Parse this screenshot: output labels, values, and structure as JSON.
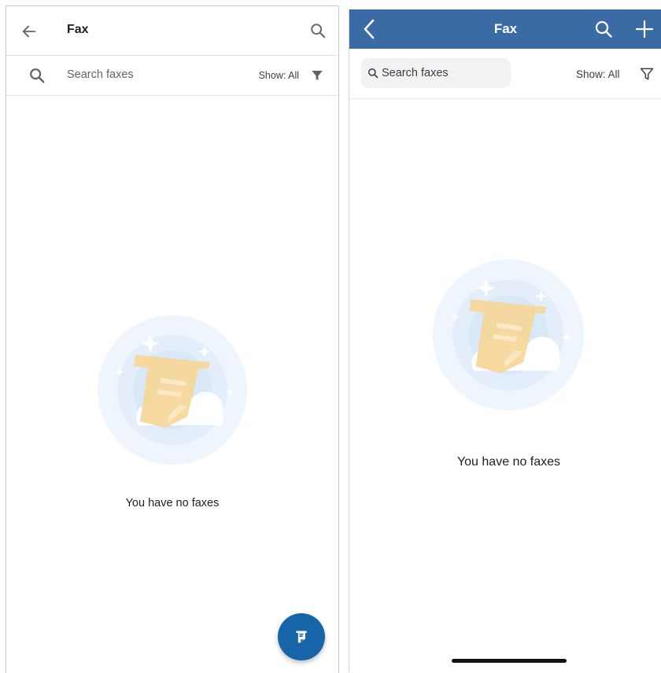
{
  "android": {
    "title": "Fax",
    "search_placeholder": "Search faxes",
    "show_filter": "Show: All",
    "empty_message": "You have no faxes",
    "icons": {
      "back": "arrow-back-icon",
      "search": "search-icon",
      "filter": "filter-funnel-icon",
      "fab": "new-fax-icon"
    },
    "colors": {
      "fab": "#1565a8"
    }
  },
  "ios": {
    "title": "Fax",
    "search_placeholder": "Search faxes",
    "show_filter": "Show: All",
    "empty_message": "You have no faxes",
    "icons": {
      "back": "chevron-left-icon",
      "search": "search-icon",
      "add": "plus-icon",
      "filter": "filter-outline-icon"
    },
    "colors": {
      "nav_bar": "#3a6ba5"
    }
  }
}
